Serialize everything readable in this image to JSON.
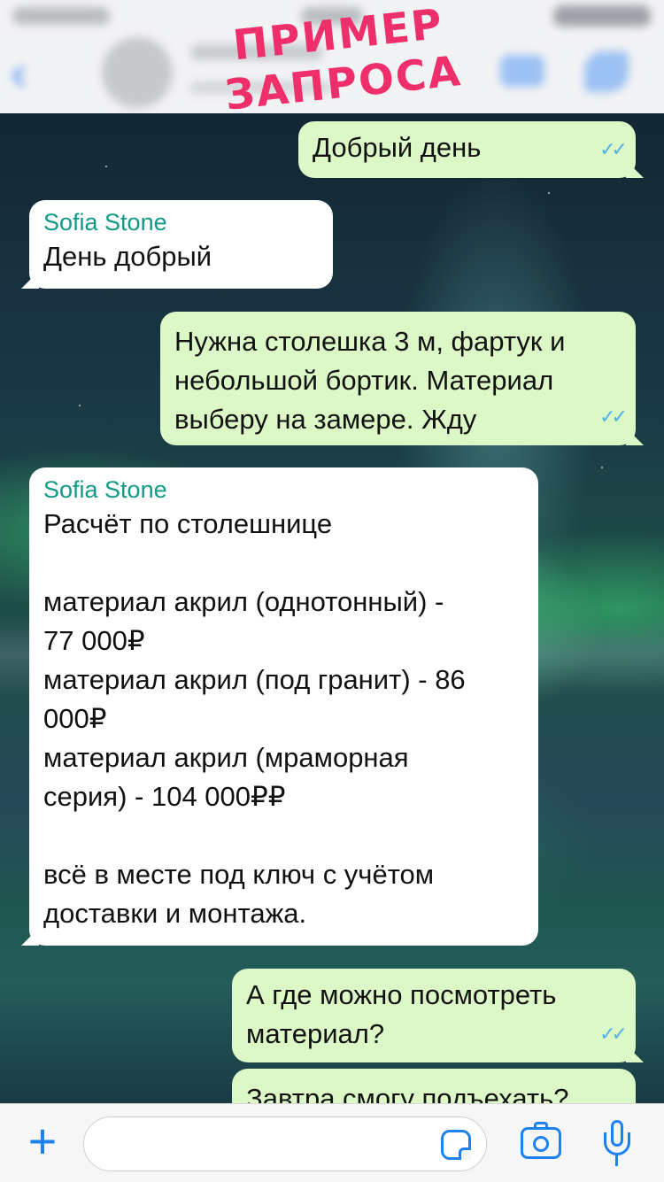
{
  "header": {
    "banner": "ПРИМЕР ЗАПРОСА",
    "accent_color": "#ee2f6c"
  },
  "messages": [
    {
      "direction": "out",
      "text": "Добрый день",
      "ticks": "✓✓"
    },
    {
      "direction": "in",
      "sender": "Sofia Stone",
      "text": "День добрый"
    },
    {
      "direction": "out",
      "text": "Нужна столешка 3 м, фартук и\nнебольшой бортик. Материал\nвыберу на замере. Жду",
      "ticks": "✓✓"
    },
    {
      "direction": "in",
      "sender": "Sofia Stone",
      "text": "Расчёт по столешнице\n\nматериал акрил (однотонный) -\n77 000₽\nматериал акрил (под гранит) - 86\n000₽\nматериал акрил (мраморная\nсерия) - 104 000₽₽\n\nвсё в месте под ключ с учётом\nдоставки и монтажа."
    },
    {
      "direction": "out",
      "text": "А где можно посмотреть\nматериал?",
      "ticks": "✓✓"
    },
    {
      "direction": "out",
      "text": "Завтра смогу подъехать?"
    }
  ],
  "input_bar": {
    "placeholder": "",
    "icons": [
      "plus-icon",
      "sticker-icon",
      "camera-icon",
      "mic-icon"
    ],
    "icon_color": "#1d82f0"
  },
  "colors": {
    "outgoing_bubble": "#dcf8c6",
    "incoming_bubble": "#ffffff",
    "sender_name": "#139a86",
    "read_ticks": "#4fb2e8"
  }
}
